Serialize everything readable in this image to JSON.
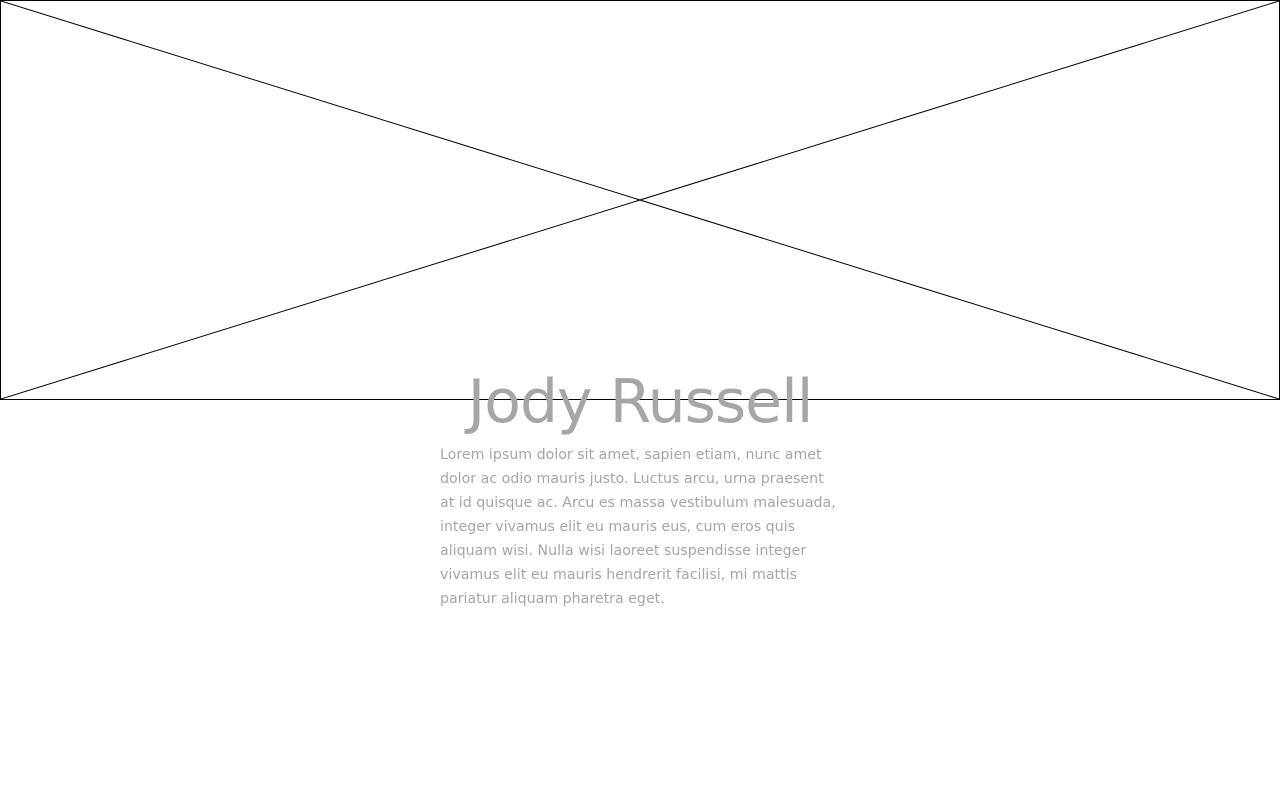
{
  "profile": {
    "name": "Jody Russell",
    "bio": "Lorem ipsum dolor sit amet, sapien etiam, nunc amet dolor ac odio mauris justo. Luctus arcu, urna praesent at id quisque ac. Arcu es massa vestibulum malesuada, integer vivamus elit eu mauris eus, cum eros quis aliquam wisi. Nulla wisi laoreet suspendisse integer vivamus elit eu mauris hendrerit facilisi, mi mattis pariatur aliquam pharetra eget."
  },
  "hero": {
    "icon": "image-placeholder-icon"
  },
  "colors": {
    "text": "#a6a6a6",
    "placeholder_stroke": "#000000",
    "background": "#ffffff"
  }
}
